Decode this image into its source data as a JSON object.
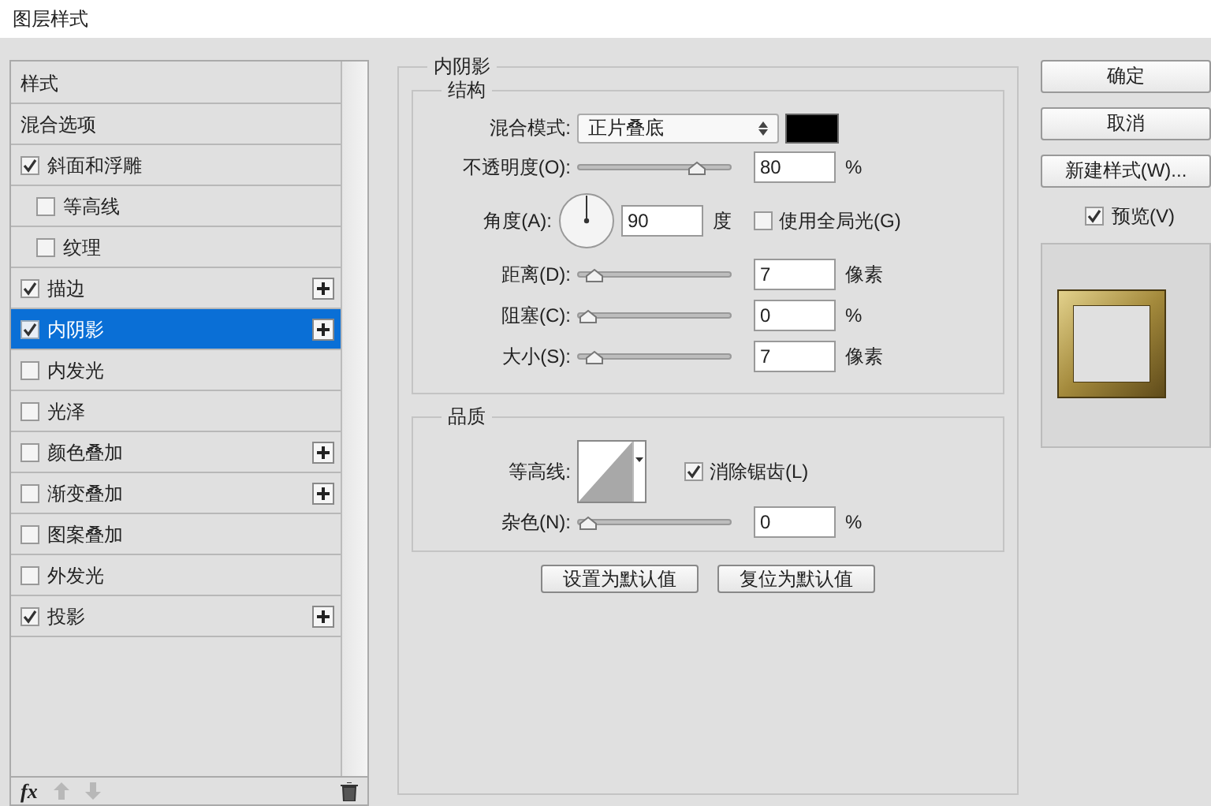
{
  "window": {
    "title": "图层样式"
  },
  "sidebar": {
    "items": [
      {
        "label": "样式",
        "kind": "header",
        "selected": false
      },
      {
        "label": "混合选项",
        "kind": "header",
        "selected": false
      },
      {
        "label": "斜面和浮雕",
        "kind": "checkbox",
        "checked": true,
        "selected": false,
        "add_button": false,
        "children": [
          {
            "label": "等高线",
            "kind": "checkbox",
            "checked": false,
            "selected": false,
            "add_button": false
          },
          {
            "label": "纹理",
            "kind": "checkbox",
            "checked": false,
            "selected": false,
            "add_button": false
          }
        ]
      },
      {
        "label": "描边",
        "kind": "checkbox",
        "checked": true,
        "selected": false,
        "add_button": true
      },
      {
        "label": "内阴影",
        "kind": "checkbox",
        "checked": true,
        "selected": true,
        "add_button": true
      },
      {
        "label": "内发光",
        "kind": "checkbox",
        "checked": false,
        "selected": false,
        "add_button": false
      },
      {
        "label": "光泽",
        "kind": "checkbox",
        "checked": false,
        "selected": false,
        "add_button": false
      },
      {
        "label": "颜色叠加",
        "kind": "checkbox",
        "checked": false,
        "selected": false,
        "add_button": true
      },
      {
        "label": "渐变叠加",
        "kind": "checkbox",
        "checked": false,
        "selected": false,
        "add_button": true
      },
      {
        "label": "图案叠加",
        "kind": "checkbox",
        "checked": false,
        "selected": false,
        "add_button": false
      },
      {
        "label": "外发光",
        "kind": "checkbox",
        "checked": false,
        "selected": false,
        "add_button": false
      },
      {
        "label": "投影",
        "kind": "checkbox",
        "checked": true,
        "selected": false,
        "add_button": true
      }
    ],
    "toolbar": {
      "fx": "fx"
    }
  },
  "panel": {
    "title": "内阴影",
    "structure": {
      "title": "结构",
      "blend_mode": {
        "label": "混合模式:",
        "value": "正片叠底",
        "color": "#000000"
      },
      "rows": [
        {
          "kind": "slider",
          "label": "不透明度(O):",
          "level": 0.8,
          "value": "80",
          "unit": "%"
        },
        {
          "kind": "angle",
          "label": "角度(A):",
          "value": "90",
          "unit": "度",
          "global_light": {
            "label": "使用全局光(G)",
            "checked": false
          }
        },
        {
          "kind": "slider",
          "label": "距离(D):",
          "level": 0.05,
          "value": "7",
          "unit": "像素"
        },
        {
          "kind": "slider",
          "label": "阻塞(C):",
          "level": 0,
          "value": "0",
          "unit": "%"
        },
        {
          "kind": "slider",
          "label": "大小(S):",
          "level": 0.05,
          "value": "7",
          "unit": "像素"
        }
      ]
    },
    "quality": {
      "title": "品质",
      "contour": {
        "label": "等高线:",
        "anti_alias": {
          "label": "消除锯齿(L)",
          "checked": true
        }
      },
      "noise": {
        "label": "杂色(N):",
        "level": 0,
        "value": "0",
        "unit": "%"
      }
    },
    "buttons": [
      "设置为默认值",
      "复位为默认值"
    ]
  },
  "actions": {
    "buttons": [
      "确定",
      "取消",
      "新建样式(W)..."
    ],
    "preview": {
      "label": "预览(V)",
      "checked": true
    }
  }
}
